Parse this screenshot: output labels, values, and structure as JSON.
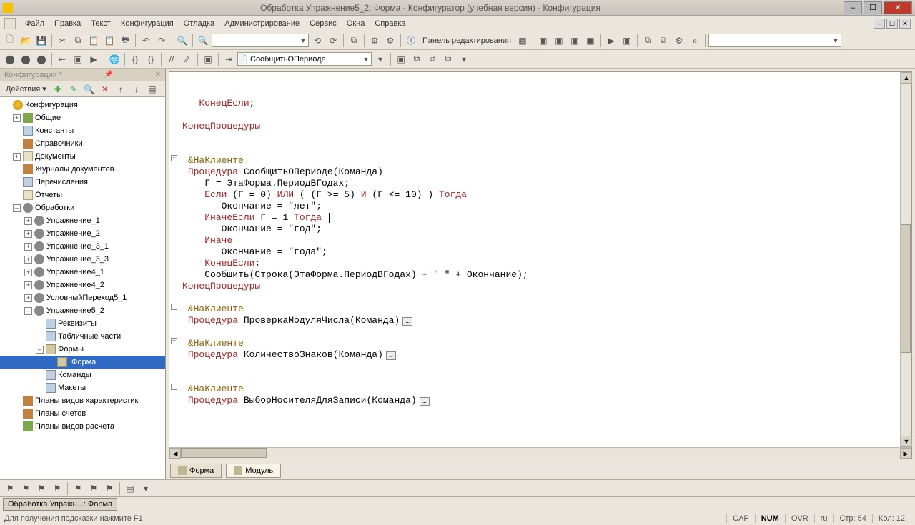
{
  "title": "Обработка Упражнение5_2: Форма - Конфигуратор (учебная версия) - Конфигурация",
  "menu": [
    "Файл",
    "Правка",
    "Текст",
    "Конфигурация",
    "Отладка",
    "Администрирование",
    "Сервис",
    "Окна",
    "Справка"
  ],
  "toolbar": {
    "panel_label": "Панель редактирования"
  },
  "proc_dropdown": "СообщитьОПериоде",
  "leftpanel": {
    "title": "Конфигурация *",
    "actions": "Действия",
    "tree": {
      "root": "Конфигурация",
      "n1": "Общие",
      "n2": "Константы",
      "n3": "Справочники",
      "n4": "Документы",
      "n5": "Журналы документов",
      "n6": "Перечисления",
      "n7": "Отчеты",
      "n8": "Обработки",
      "e1": "Упражнение_1",
      "e2": "Упражнение_2",
      "e3": "Упражнение_3_1",
      "e4": "Упражнение_3_3",
      "e5": "Упражнение4_1",
      "e6": "Упражнение4_2",
      "e7": "УсловныйПереход5_1",
      "e8": "Упражнение5_2",
      "s1": "Реквизиты",
      "s2": "Табличные части",
      "s3": "Формы",
      "s4": "Форма",
      "s5": "Команды",
      "s6": "Макеты",
      "n9": "Планы видов характеристик",
      "n10": "Планы счетов",
      "n11": "Планы видов расчета"
    }
  },
  "code": {
    "l1": "КонецЕсли",
    "l2": "КонецПроцедуры",
    "dir": "&НаКлиенте",
    "proc": "Процедура",
    "p1": "СообщитьОПериоде(Команда)",
    "b1a": "Г = ЭтаФорма.ПериодВГодах;",
    "b2_if": "Если",
    "b2_or": "ИЛИ",
    "b2_and": "И",
    "b2_then": "Тогда",
    "b2a": "(Г = 0)",
    "b2b": "( (Г >= 5)",
    "b2c": "(Г <= 10) )",
    "b3": "Окончание = \"лет\";",
    "b4a": "ИначеЕсли",
    "b4b": "Г = 1",
    "b4c": "Тогда",
    "b5": "Окончание = \"год\";",
    "b6": "Иначе",
    "b7": "Окончание = \"года\";",
    "b8": "КонецЕсли",
    "b9a": "Сообщить(Строка(ЭтаФорма.ПериодВГодах) + \" \" + Окончание);",
    "b10": "КонецПроцедуры",
    "p2": "ПроверкаМодуляЧисла(Команда)",
    "p3": "КоличествоЗнаков(Команда)",
    "p4": "ВыборНосителяДляЗаписи(Команда)"
  },
  "tabs": {
    "form": "Форма",
    "module": "Модуль"
  },
  "wintab": "Обработка Упражн...: Форма",
  "status": {
    "hint": "Для получения подсказки нажмите F1",
    "cap": "CAP",
    "num": "NUM",
    "ovr": "OVR",
    "lang": "ru",
    "line_lbl": "Стр:",
    "line": "54",
    "col_lbl": "Кол:",
    "col": "12"
  }
}
